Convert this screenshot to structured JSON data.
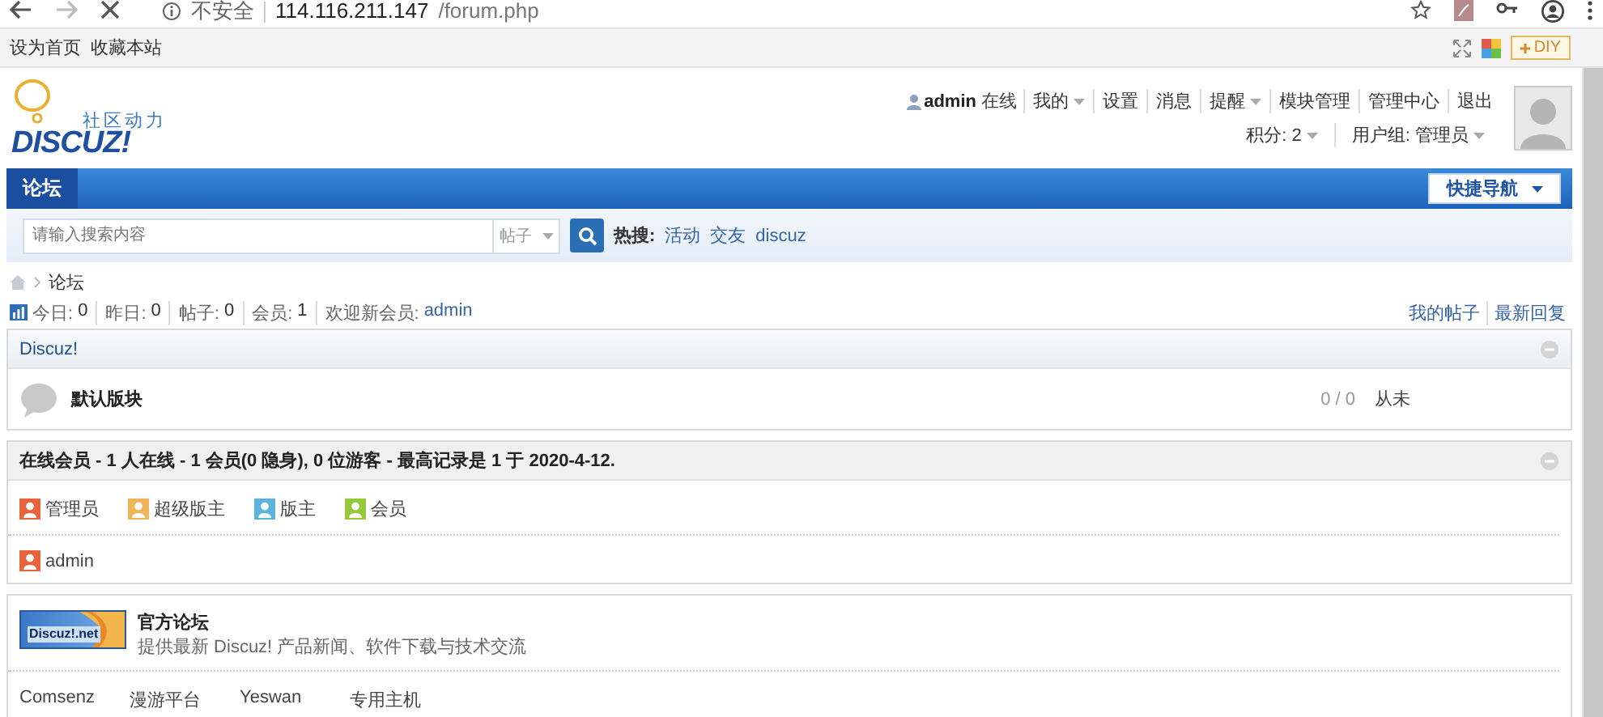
{
  "browser": {
    "security": "不安全",
    "url_host": "114.116.211.147",
    "url_path": "/forum.php"
  },
  "toolbar": {
    "links": [
      "设为首页",
      "收藏本站"
    ],
    "diy": "DIY"
  },
  "logo": {
    "tagline": "社区动力",
    "wordmark": "DISCUZ!"
  },
  "user": {
    "name": "admin",
    "status": "在线",
    "links": [
      {
        "label": "我的",
        "dropdown": true
      },
      {
        "label": "设置",
        "dropdown": false
      },
      {
        "label": "消息",
        "dropdown": false
      },
      {
        "label": "提醒",
        "dropdown": true
      },
      {
        "label": "模块管理",
        "dropdown": false
      },
      {
        "label": "管理中心",
        "dropdown": false
      },
      {
        "label": "退出",
        "dropdown": false
      }
    ],
    "info": [
      {
        "label": "积分: 2",
        "dropdown": true
      },
      {
        "label": "用户组: 管理员",
        "dropdown": true
      }
    ]
  },
  "nav": {
    "items": [
      {
        "label": "论坛",
        "selected": true
      }
    ],
    "quick_nav": "快捷导航"
  },
  "search": {
    "placeholder": "请输入搜索内容",
    "type": "帖子",
    "hot_label": "热搜:",
    "hot": [
      "活动",
      "交友",
      "discuz"
    ]
  },
  "breadcrumb": [
    "论坛"
  ],
  "stats": [
    {
      "label": "今日:",
      "value": "0"
    },
    {
      "label": "昨日:",
      "value": "0"
    },
    {
      "label": "帖子:",
      "value": "0"
    },
    {
      "label": "会员:",
      "value": "1"
    }
  ],
  "welcome": {
    "label": "欢迎新会员:",
    "member": "admin"
  },
  "my_links": [
    "我的帖子",
    "最新回复"
  ],
  "category": {
    "title": "Discuz!",
    "forums": [
      {
        "name": "默认版块",
        "counts": "0 / 0",
        "last_post": "从未"
      }
    ]
  },
  "online": {
    "title": "在线会员 - 1 人在线 - 1 会员(0 隐身), 0 位游客 - 最高记录是 1 于 2020-4-12.",
    "legend": [
      {
        "label": "管理员",
        "color": "#e8643c"
      },
      {
        "label": "超级版主",
        "color": "#f0b45a"
      },
      {
        "label": "版主",
        "color": "#5ab4dc"
      },
      {
        "label": "会员",
        "color": "#96c83c"
      }
    ],
    "members": [
      {
        "name": "admin",
        "color": "#e8643c"
      }
    ]
  },
  "links": {
    "site": {
      "banner_text": "Discuz!.net",
      "name": "官方论坛",
      "description": "提供最新 Discuz! 产品新闻、软件下载与技术交流"
    },
    "text_links": [
      "Comsenz",
      "漫游平台",
      "Yeswan",
      "专用主机"
    ]
  }
}
